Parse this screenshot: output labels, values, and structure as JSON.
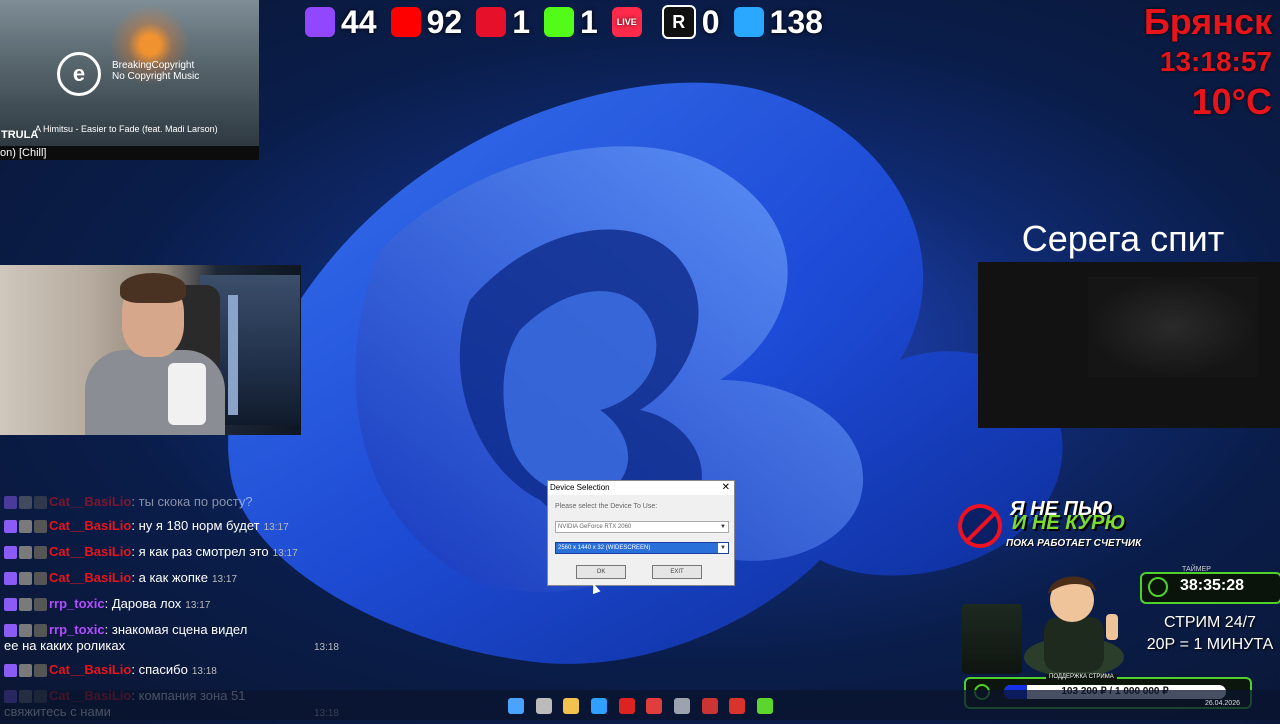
{
  "stats": [
    {
      "icon": "twitch-icon",
      "color": "#9146ff",
      "value": "44"
    },
    {
      "icon": "youtube-icon",
      "color": "#ff0000",
      "value": "92"
    },
    {
      "icon": "rutube-icon",
      "color": "#e6102b",
      "value": "1"
    },
    {
      "icon": "kick-icon",
      "color": "#53fc18",
      "value": "1"
    },
    {
      "icon": "vklive-icon",
      "color": "#ff2a4a",
      "label": "LIVE",
      "value": ""
    },
    {
      "icon": "r-icon",
      "color": "#111111",
      "label": "R",
      "value": "0"
    },
    {
      "icon": "viewers-icon",
      "color": "#2aa7ff",
      "value": "138"
    }
  ],
  "city": {
    "name": "Брянск",
    "time": "13:18:57",
    "temp": "10°C"
  },
  "music": {
    "brand_line1": "BreakingCopyright",
    "brand_line2": "No Copyright Music",
    "track": "A Himitsu - Easier to Fade (feat. Madi Larson)",
    "overlay_text": "TRULA",
    "subtitle": "on) [Chill]"
  },
  "serega": {
    "label": "Серега спит"
  },
  "chat": [
    {
      "nick": "Cat__BasiLio",
      "color": "#e8141b",
      "text": "ты скока по росту?",
      "time": "",
      "faded": true
    },
    {
      "nick": "Cat__BasiLio",
      "color": "#e8141b",
      "text": "ну я 180 норм будет",
      "time": "13:17"
    },
    {
      "nick": "Cat__BasiLio",
      "color": "#e8141b",
      "text": "я как раз смотрел это",
      "time": "13:17"
    },
    {
      "nick": "Cat__BasiLio",
      "color": "#e8141b",
      "text": "а как жопке",
      "time": "13:17"
    },
    {
      "nick": "rrp_toxic",
      "color": "#b14cff",
      "text": "Дарова лох",
      "time": "13:17"
    },
    {
      "nick": "rrp_toxic",
      "color": "#b14cff",
      "text": "знакомая сцена видел ее на каких роликах",
      "time": "13:18",
      "time_right": true
    },
    {
      "nick": "Cat__BasiLio",
      "color": "#e8141b",
      "text": "спасибо",
      "time": "13:18"
    },
    {
      "nick": "Cat__BasiLio",
      "color": "#e8141b",
      "text": "компания зона 51 свяжитесь с нами",
      "time": "13:18",
      "time_right": true
    }
  ],
  "dialog": {
    "title": "Device Selection",
    "close": "✕",
    "prompt": "Please select the Device To Use:",
    "device": "NVIDIA GeForce RTX 2060",
    "mode": "2560 x 1440 x 32 (WIDESCREEN)",
    "ok": "OK",
    "exit": "EXIT"
  },
  "banner": {
    "line1": "Я НЕ ПЬЮ",
    "line2": "И НЕ КУРЮ",
    "line3": "ПОКА РАБОТАЕТ СЧЕТЧИК"
  },
  "timer": {
    "caption": "ТАЙМЕР",
    "value": "38:35:28"
  },
  "stream": {
    "line1": "СТРИМ 24/7",
    "line2": "20Р = 1 МИНУТА"
  },
  "donate": {
    "caption": "ПОДДЕРЖКА СТРИМА",
    "text": "103 200 ₽ / 1 000 000 ₽",
    "progress": 0.1032
  },
  "taskbar": {
    "icons": [
      "windows-start-icon",
      "task-view-icon",
      "file-explorer-icon",
      "edge-icon",
      "app-red-icon",
      "app-w-icon",
      "app-gear-icon",
      "app-media-icon",
      "app-red2-icon",
      "app-play-icon"
    ],
    "date": "26.04.2026"
  }
}
